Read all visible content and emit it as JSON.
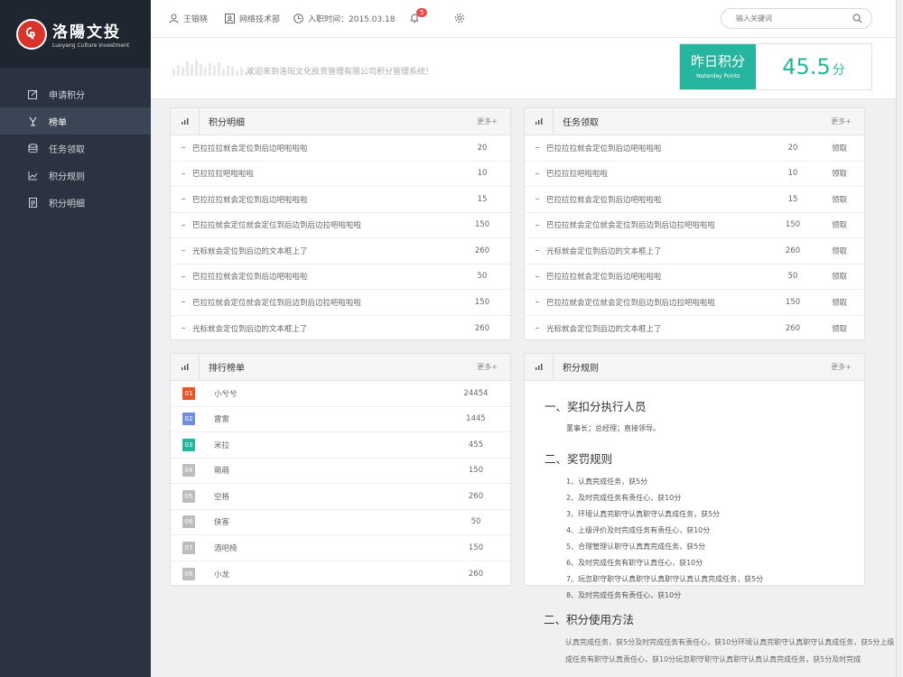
{
  "brand": {
    "name_cn": "洛陽文投",
    "name_en": "Luoyang Culture Investment"
  },
  "sidebar": {
    "items": [
      {
        "label": "申请积分",
        "icon": "edit-icon"
      },
      {
        "label": "榜单",
        "icon": "trophy-icon"
      },
      {
        "label": "任务领取",
        "icon": "database-icon"
      },
      {
        "label": "积分规则",
        "icon": "chart-icon"
      },
      {
        "label": "积分明细",
        "icon": "document-icon"
      }
    ]
  },
  "topbar": {
    "user": "王银晓",
    "department": "网络技术部",
    "join_date": "入职时间：2015.03.18",
    "notifications": "5",
    "search_placeholder": "输入关键词"
  },
  "welcome": {
    "text": "欢迎来到洛阳文化投资管理有限公司积分管理系统！",
    "points_label_cn": "昨日积分",
    "points_label_en": "Yesterday Points",
    "points_value": "45.5",
    "points_unit": "分"
  },
  "points_detail": {
    "title": "积分明细",
    "more": "更多+",
    "rows": [
      {
        "text": "巴拉拉拉就会定位到后边吧啦啦啦",
        "value": "20"
      },
      {
        "text": "巴拉拉拉吧啦啦啦",
        "value": "10"
      },
      {
        "text": "巴拉拉拉就会定位到后边吧啦啦啦",
        "value": "15"
      },
      {
        "text": "巴拉拉就会定位就会定位到后边到后边拉吧啦啦啦",
        "value": "150"
      },
      {
        "text": "光标就会定位到后边的文本框上了",
        "value": "260"
      },
      {
        "text": "巴拉拉拉就会定位到后边吧啦啦啦",
        "value": "50"
      },
      {
        "text": "巴拉拉就会定位就会定位到后边到后边拉吧啦啦啦",
        "value": "150"
      },
      {
        "text": "光标就会定位到后边的文本框上了",
        "value": "260"
      }
    ]
  },
  "tasks": {
    "title": "任务领取",
    "more": "更多+",
    "action": "领取",
    "rows": [
      {
        "text": "巴拉拉拉就会定位到后边吧啦啦啦",
        "value": "20"
      },
      {
        "text": "巴拉拉拉吧啦啦啦",
        "value": "10"
      },
      {
        "text": "巴拉拉拉就会定位到后边吧啦啦啦",
        "value": "15"
      },
      {
        "text": "巴拉拉就会定位就会定位到后边到后边拉吧啦啦啦",
        "value": "150"
      },
      {
        "text": "光标就会定位到后边的文本框上了",
        "value": "260"
      },
      {
        "text": "巴拉拉拉就会定位到后边吧啦啦啦",
        "value": "50"
      },
      {
        "text": "巴拉拉就会定位就会定位到后边到后边拉吧啦啦啦",
        "value": "150"
      },
      {
        "text": "光标就会定位到后边的文本框上了",
        "value": "260"
      }
    ]
  },
  "ranking": {
    "title": "排行榜单",
    "more": "更多+",
    "rows": [
      {
        "rank": "01",
        "name": "小兮兮",
        "value": "24454",
        "color": "#e8572a"
      },
      {
        "rank": "02",
        "name": "雷雷",
        "value": "1445",
        "color": "#6f8fdc"
      },
      {
        "rank": "03",
        "name": "米拉",
        "value": "455",
        "color": "#26b59e"
      },
      {
        "rank": "04",
        "name": "萌萌",
        "value": "150",
        "color": "#bdbdbd"
      },
      {
        "rank": "05",
        "name": "空格",
        "value": "260",
        "color": "#bdbdbd"
      },
      {
        "rank": "06",
        "name": "侠客",
        "value": "50",
        "color": "#bdbdbd"
      },
      {
        "rank": "07",
        "name": "酒吧椅",
        "value": "150",
        "color": "#bdbdbd"
      },
      {
        "rank": "08",
        "name": "小龙",
        "value": "260",
        "color": "#bdbdbd"
      }
    ]
  },
  "rules": {
    "title": "积分规则",
    "more": "更多+",
    "section1_title": "一、奖扣分执行人员",
    "section1_text": "董事长；总经理；直接领导。",
    "section2_title": "二、奖罚规则",
    "section2_items": [
      "1、认真完成任务，获5分",
      "2、及时完成任务有责任心，获10分",
      "3、环境认真完职守认真职守认真成任务，获5分",
      "4、上级评价及时完成任务有责任心，获10分",
      "5、合理管理认职守认真真完成任务，获5分",
      "6、及时完成任务有职守认真任心，获10分",
      "7、玩忽职守职守认真职守认真职守认真认真完成任务，获5分",
      "8、及时完成任务有责任心，获10分"
    ],
    "section3_title": "二、积分使用方法",
    "section3_lines": [
      "认真完成任务，获5分及时完成任务有责任心，获10分环境认真完职守认真职守认真成任务，获5分上级",
      "成任务有职守认真责任心，获10分玩忽职守职守认真职守认真认真完成任务，获5分及时完成"
    ]
  }
}
